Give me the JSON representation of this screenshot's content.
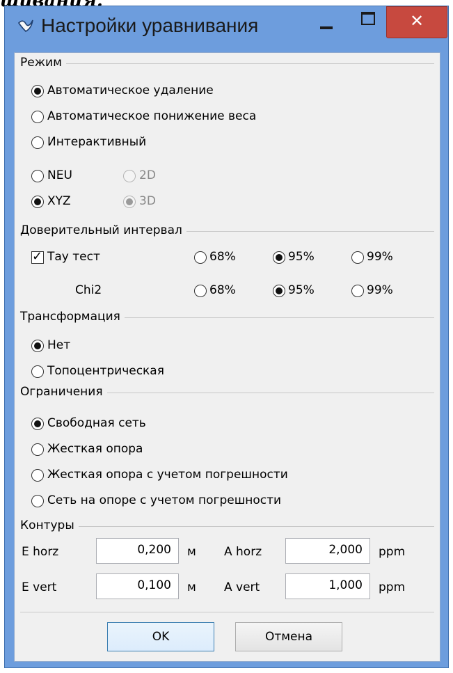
{
  "doc_fragment": "шивания.",
  "window": {
    "title": "Настройки уравнивания",
    "close_glyph": "✕",
    "icon": "checkmark-icon"
  },
  "mode": {
    "title": "Режим",
    "options": [
      "Автоматическое удаление",
      "Автоматическое понижение веса",
      "Интерактивный"
    ],
    "selected": "Автоматическое удаление",
    "coord": {
      "neu": "NEU",
      "xyz": "XYZ",
      "d2": "2D",
      "d3": "3D",
      "selected_system": "XYZ",
      "selected_dim": "3D",
      "dim_disabled": true
    }
  },
  "confidence": {
    "title": "Доверительный интервал",
    "tau_label": "Тау тест",
    "tau_checked": true,
    "tau_options": [
      "68%",
      "95%",
      "99%"
    ],
    "tau_selected": "95%",
    "chi_label": "Chi2",
    "chi_options": [
      "68%",
      "95%",
      "99%"
    ],
    "chi_selected": "95%"
  },
  "transform": {
    "title": "Трансформация",
    "options": [
      "Нет",
      "Топоцентрическая"
    ],
    "selected": "Нет"
  },
  "constraints": {
    "title": "Ограничения",
    "options": [
      "Свободная сеть",
      "Жесткая опора",
      "Жесткая опора с учетом погрешности",
      "Сеть на опоре с учетом погрешности"
    ],
    "selected": "Свободная сеть"
  },
  "contours": {
    "title": "Контуры",
    "e_horz_label": "E horz",
    "e_horz_value": "0,200",
    "e_unit": "м",
    "a_horz_label": "A horz",
    "a_horz_value": "2,000",
    "a_unit": "ppm",
    "e_vert_label": "E vert",
    "e_vert_value": "0,100",
    "a_vert_label": "A vert",
    "a_vert_value": "1,000"
  },
  "buttons": {
    "ok": "OK",
    "cancel": "Отмена"
  },
  "colors": {
    "titlebar": "#6d9ddd",
    "close": "#c7493f",
    "client": "#f0f0f0"
  }
}
